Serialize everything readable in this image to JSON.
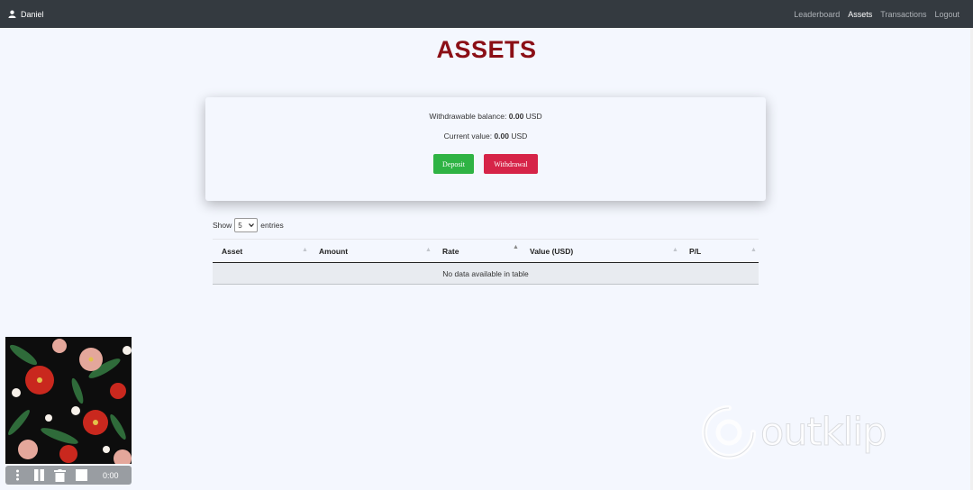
{
  "navbar": {
    "user": "Daniel",
    "links": [
      "Leaderboard",
      "Assets",
      "Transactions",
      "Logout"
    ],
    "active": "Assets"
  },
  "page": {
    "title": "ASSETS"
  },
  "balance": {
    "withdrawable_label": "Withdrawable balance:",
    "withdrawable_value": "0.00",
    "withdrawable_unit": "USD",
    "current_label": "Current value:",
    "current_value": "0.00",
    "current_unit": "USD",
    "deposit_label": "Deposit",
    "withdrawal_label": "Withdrawal"
  },
  "table": {
    "show_label": "Show",
    "entries_value": "5",
    "entries_label": "entries",
    "columns": [
      "Asset",
      "Amount",
      "Rate",
      "Value (USD)",
      "P/L"
    ],
    "empty_message": "No data available in table"
  },
  "player": {
    "time": "0:00"
  },
  "watermark": {
    "text": "outklip"
  },
  "colors": {
    "navbar": "#343a40",
    "title": "#8b0f16",
    "deposit": "#2fb344",
    "withdrawal": "#d62448",
    "background": "#f4f7fe"
  },
  "icons": [
    "user-icon",
    "sort-icon",
    "select-chevron-icon",
    "menu-dots-icon",
    "pause-icon",
    "trash-icon",
    "stop-icon",
    "outklip-logo-icon"
  ]
}
